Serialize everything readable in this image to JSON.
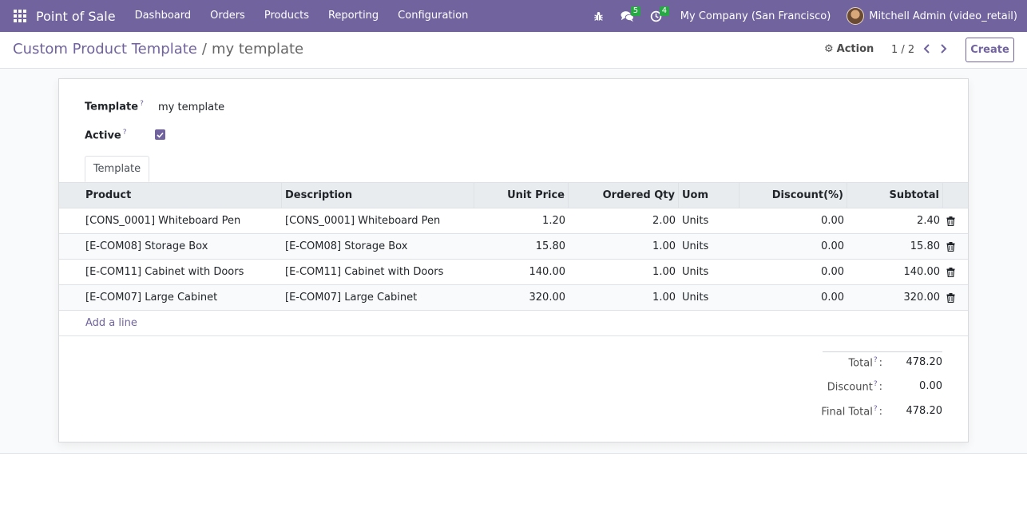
{
  "navbar": {
    "app_name": "Point of Sale",
    "menu": [
      "Dashboard",
      "Orders",
      "Products",
      "Reporting",
      "Configuration"
    ],
    "messages_count": "5",
    "activities_count": "4",
    "company": "My Company (San Francisco)",
    "user": "Mitchell Admin (video_retail)"
  },
  "control": {
    "breadcrumb_parent": "Custom Product Template",
    "breadcrumb_sep": "/",
    "breadcrumb_current": "my template",
    "action_label": "Action",
    "pager": "1 / 2",
    "create_label": "Create"
  },
  "form": {
    "template_label": "Template",
    "template_value": "my template",
    "active_label": "Active",
    "active_checked": true,
    "help_mark": "?",
    "tab_label": "Template"
  },
  "table": {
    "headers": [
      "Product",
      "Description",
      "Unit Price",
      "Ordered Qty",
      "Uom",
      "Discount(%)",
      "Subtotal"
    ],
    "rows": [
      {
        "product": "[CONS_0001] Whiteboard Pen",
        "description": "[CONS_0001] Whiteboard Pen",
        "price": "1.20",
        "qty": "2.00",
        "uom": "Units",
        "discount": "0.00",
        "subtotal": "2.40"
      },
      {
        "product": "[E-COM08] Storage Box",
        "description": "[E-COM08] Storage Box",
        "price": "15.80",
        "qty": "1.00",
        "uom": "Units",
        "discount": "0.00",
        "subtotal": "15.80"
      },
      {
        "product": "[E-COM11] Cabinet with Doors",
        "description": "[E-COM11] Cabinet with Doors",
        "price": "140.00",
        "qty": "1.00",
        "uom": "Units",
        "discount": "0.00",
        "subtotal": "140.00"
      },
      {
        "product": "[E-COM07] Large Cabinet",
        "description": "[E-COM07] Large Cabinet",
        "price": "320.00",
        "qty": "1.00",
        "uom": "Units",
        "discount": "0.00",
        "subtotal": "320.00"
      }
    ],
    "add_line": "Add a line"
  },
  "totals": {
    "total_label": "Total",
    "total_value": "478.20",
    "discount_label": "Discount",
    "discount_value": "0.00",
    "final_label": "Final Total",
    "final_value": "478.20"
  },
  "colors": {
    "brand": "#71639e",
    "badge": "#28a745"
  }
}
